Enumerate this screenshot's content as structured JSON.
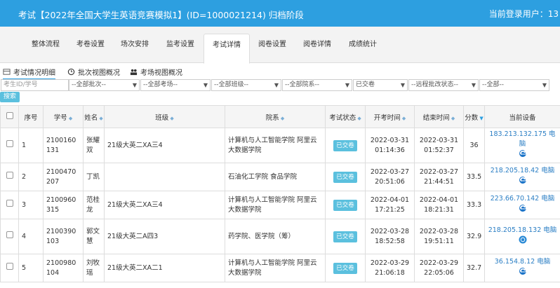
{
  "header": {
    "title": "考试【2022年全国大学生英语竞赛模拟1】(ID=1000021214) 归档阶段",
    "user": "当前登录用户：13"
  },
  "tabs": [
    {
      "label": "整体流程"
    },
    {
      "label": "考卷设置"
    },
    {
      "label": "场次安排"
    },
    {
      "label": "监考设置"
    },
    {
      "label": "考试详情"
    },
    {
      "label": "阅卷设置"
    },
    {
      "label": "阅卷详情"
    },
    {
      "label": "成绩统计"
    }
  ],
  "subtabs": [
    {
      "label": "考试情况明细"
    },
    {
      "label": "批次视图概况"
    },
    {
      "label": "考场视图概况"
    }
  ],
  "filters": {
    "student_placeholder": "考生ID/学号",
    "batch": "--全部批次--",
    "room": "--全部考场--",
    "class": "--全部班级--",
    "dept": "--全部院系--",
    "status": "已交卷",
    "remote": "--远程批改状态--",
    "all": "--全部--",
    "search": "搜索"
  },
  "table": {
    "headers": {
      "no": "序号",
      "id": "学号",
      "name": "姓名",
      "class": "班级",
      "dept": "院系",
      "status": "考试状态",
      "start": "开考时间",
      "end": "结束时间",
      "score": "分数",
      "device": "当前设备"
    },
    "rows": [
      {
        "no": "1",
        "id": "2100160131",
        "name": "张耀双",
        "class": "21级大英二XA三4",
        "dept": "计算机与人工智能学院 阿里云大数据学院",
        "status": "已交卷",
        "start": "2022-03-31 01:14:36",
        "end": "2022-03-31 01:52:37",
        "score": "36",
        "ip": "183.213.132.175",
        "dev": "电脑",
        "browser": "edge-icon"
      },
      {
        "no": "2",
        "id": "2100470207",
        "name": "丁凯",
        "class": "",
        "dept": "石油化工学院 食品学院",
        "status": "已交卷",
        "start": "2022-03-27 20:51:06",
        "end": "2022-03-27 21:44:51",
        "score": "33.5",
        "ip": "218.205.18.42",
        "dev": "电脑",
        "browser": "edge-icon"
      },
      {
        "no": "3",
        "id": "2100960315",
        "name": "范桂龙",
        "class": "21级大英二XA三4",
        "dept": "计算机与人工智能学院 阿里云大数据学院",
        "status": "已交卷",
        "start": "2022-04-01 17:21:25",
        "end": "2022-04-01 18:21:31",
        "score": "33.3",
        "ip": "223.66.70.142",
        "dev": "电脑",
        "browser": "edge-icon"
      },
      {
        "no": "4",
        "id": "2100390103",
        "name": "郭文慧",
        "class": "21级大英二A四3",
        "dept": "药学院、医学院（筹）",
        "status": "已交卷",
        "start": "2022-03-28 18:52:58",
        "end": "2022-03-28 19:51:11",
        "score": "32.9",
        "ip": "218.205.18.132",
        "dev": "电脑",
        "browser": "chrome-icon"
      },
      {
        "no": "5",
        "id": "2100980104",
        "name": "刘牧瑶",
        "class": "21级大英二XA二1",
        "dept": "计算机与人工智能学院 阿里云大数据学院",
        "status": "已交卷",
        "start": "2022-03-29 21:06:18",
        "end": "2022-03-29 22:05:06",
        "score": "32.7",
        "ip": "36.154.8.12",
        "dev": "电脑",
        "browser": "edge-icon"
      }
    ]
  },
  "colors": {
    "primary": "#2d9fe0",
    "badge": "#5bc0de",
    "link": "#2a7ec4"
  }
}
